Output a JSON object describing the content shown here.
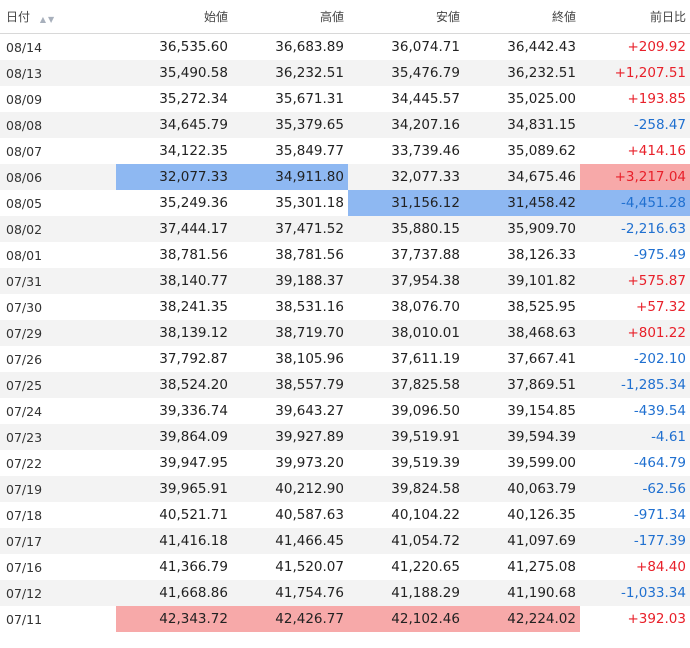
{
  "headers": [
    "日付",
    "始値",
    "高値",
    "安値",
    "終値",
    "前日比"
  ],
  "rows": [
    {
      "date": "08/14",
      "open": "36,535.60",
      "high": "36,683.89",
      "low": "36,074.71",
      "close": "36,442.43",
      "change": "+209.92",
      "dir": "pos",
      "hl": {}
    },
    {
      "date": "08/13",
      "open": "35,490.58",
      "high": "36,232.51",
      "low": "35,476.79",
      "close": "36,232.51",
      "change": "+1,207.51",
      "dir": "pos",
      "hl": {}
    },
    {
      "date": "08/09",
      "open": "35,272.34",
      "high": "35,671.31",
      "low": "34,445.57",
      "close": "35,025.00",
      "change": "+193.85",
      "dir": "pos",
      "hl": {}
    },
    {
      "date": "08/08",
      "open": "34,645.79",
      "high": "35,379.65",
      "low": "34,207.16",
      "close": "34,831.15",
      "change": "-258.47",
      "dir": "neg",
      "hl": {}
    },
    {
      "date": "08/07",
      "open": "34,122.35",
      "high": "35,849.77",
      "low": "33,739.46",
      "close": "35,089.62",
      "change": "+414.16",
      "dir": "pos",
      "hl": {}
    },
    {
      "date": "08/06",
      "open": "32,077.33",
      "high": "34,911.80",
      "low": "32,077.33",
      "close": "34,675.46",
      "change": "+3,217.04",
      "dir": "pos",
      "hl": {
        "open": "blue",
        "high": "blue",
        "change": "red"
      }
    },
    {
      "date": "08/05",
      "open": "35,249.36",
      "high": "35,301.18",
      "low": "31,156.12",
      "close": "31,458.42",
      "change": "-4,451.28",
      "dir": "neg",
      "hl": {
        "low": "blue",
        "close": "blue",
        "change": "blue"
      }
    },
    {
      "date": "08/02",
      "open": "37,444.17",
      "high": "37,471.52",
      "low": "35,880.15",
      "close": "35,909.70",
      "change": "-2,216.63",
      "dir": "neg",
      "hl": {}
    },
    {
      "date": "08/01",
      "open": "38,781.56",
      "high": "38,781.56",
      "low": "37,737.88",
      "close": "38,126.33",
      "change": "-975.49",
      "dir": "neg",
      "hl": {}
    },
    {
      "date": "07/31",
      "open": "38,140.77",
      "high": "39,188.37",
      "low": "37,954.38",
      "close": "39,101.82",
      "change": "+575.87",
      "dir": "pos",
      "hl": {}
    },
    {
      "date": "07/30",
      "open": "38,241.35",
      "high": "38,531.16",
      "low": "38,076.70",
      "close": "38,525.95",
      "change": "+57.32",
      "dir": "pos",
      "hl": {}
    },
    {
      "date": "07/29",
      "open": "38,139.12",
      "high": "38,719.70",
      "low": "38,010.01",
      "close": "38,468.63",
      "change": "+801.22",
      "dir": "pos",
      "hl": {}
    },
    {
      "date": "07/26",
      "open": "37,792.87",
      "high": "38,105.96",
      "low": "37,611.19",
      "close": "37,667.41",
      "change": "-202.10",
      "dir": "neg",
      "hl": {}
    },
    {
      "date": "07/25",
      "open": "38,524.20",
      "high": "38,557.79",
      "low": "37,825.58",
      "close": "37,869.51",
      "change": "-1,285.34",
      "dir": "neg",
      "hl": {}
    },
    {
      "date": "07/24",
      "open": "39,336.74",
      "high": "39,643.27",
      "low": "39,096.50",
      "close": "39,154.85",
      "change": "-439.54",
      "dir": "neg",
      "hl": {}
    },
    {
      "date": "07/23",
      "open": "39,864.09",
      "high": "39,927.89",
      "low": "39,519.91",
      "close": "39,594.39",
      "change": "-4.61",
      "dir": "neg",
      "hl": {}
    },
    {
      "date": "07/22",
      "open": "39,947.95",
      "high": "39,973.20",
      "low": "39,519.39",
      "close": "39,599.00",
      "change": "-464.79",
      "dir": "neg",
      "hl": {}
    },
    {
      "date": "07/19",
      "open": "39,965.91",
      "high": "40,212.90",
      "low": "39,824.58",
      "close": "40,063.79",
      "change": "-62.56",
      "dir": "neg",
      "hl": {}
    },
    {
      "date": "07/18",
      "open": "40,521.71",
      "high": "40,587.63",
      "low": "40,104.22",
      "close": "40,126.35",
      "change": "-971.34",
      "dir": "neg",
      "hl": {}
    },
    {
      "date": "07/17",
      "open": "41,416.18",
      "high": "41,466.45",
      "low": "41,054.72",
      "close": "41,097.69",
      "change": "-177.39",
      "dir": "neg",
      "hl": {}
    },
    {
      "date": "07/16",
      "open": "41,366.79",
      "high": "41,520.07",
      "low": "41,220.65",
      "close": "41,275.08",
      "change": "+84.40",
      "dir": "pos",
      "hl": {}
    },
    {
      "date": "07/12",
      "open": "41,668.86",
      "high": "41,754.76",
      "low": "41,188.29",
      "close": "41,190.68",
      "change": "-1,033.34",
      "dir": "neg",
      "hl": {}
    },
    {
      "date": "07/11",
      "open": "42,343.72",
      "high": "42,426.77",
      "low": "42,102.46",
      "close": "42,224.02",
      "change": "+392.03",
      "dir": "pos",
      "hl": {
        "open": "red",
        "high": "red",
        "low": "red",
        "close": "red"
      }
    }
  ],
  "colors": {
    "positive": "#e8202a",
    "negative": "#2070d0",
    "highlight_blue": "#8eb8f2",
    "highlight_red": "#f7a9a9",
    "stripe": "#f3f3f3"
  },
  "icons": {
    "sort_asc": "sort-asc-icon",
    "sort_desc": "sort-desc-icon"
  }
}
